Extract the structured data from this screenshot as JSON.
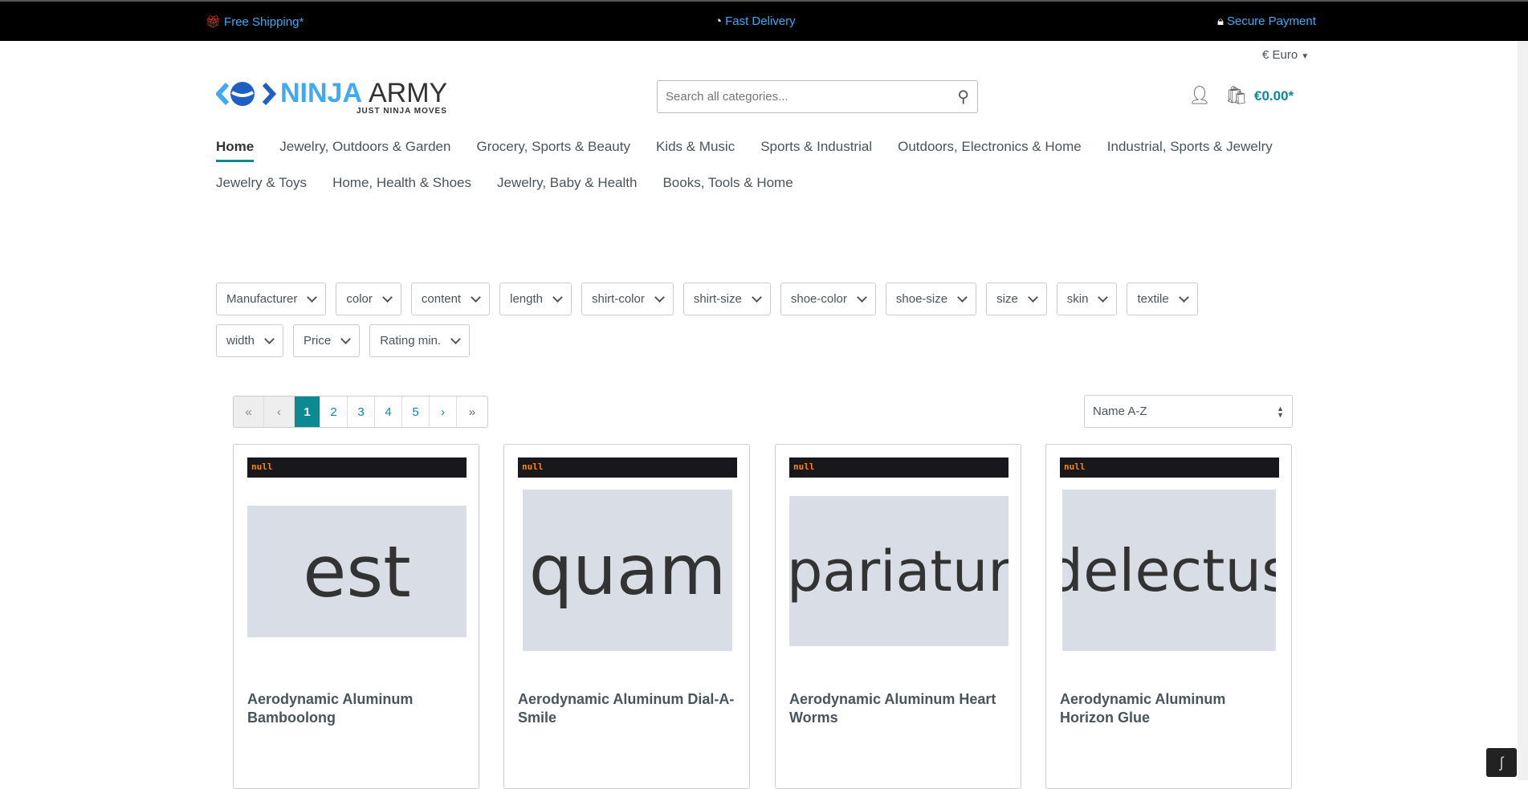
{
  "topbar": {
    "shipping": "Free Shipping*",
    "delivery": "Fast Delivery",
    "payment": "Secure Payment"
  },
  "header": {
    "currency": "€ Euro",
    "search_placeholder": "Search all categories...",
    "cart_total": "€0.00*",
    "logo_text": "NINJA ARMY",
    "logo_tagline": "JUST NINJA MOVES"
  },
  "nav": {
    "row1": [
      "Home",
      "Jewelry, Outdoors & Garden",
      "Grocery, Sports & Beauty",
      "Kids & Music",
      "Sports & Industrial",
      "Outdoors, Electronics & Home",
      "Industrial, Sports & Jewelry"
    ],
    "row2": [
      "Jewelry & Toys",
      "Home, Health & Shoes",
      "Jewelry, Baby & Health",
      "Books, Tools & Home"
    ]
  },
  "filters": {
    "row1": [
      "Manufacturer",
      "color",
      "content",
      "length",
      "shirt-color",
      "shirt-size",
      "shoe-color",
      "shoe-size",
      "size",
      "skin",
      "textile"
    ],
    "row2": [
      "width",
      "Price",
      "Rating min."
    ]
  },
  "pagination": {
    "first": "«",
    "prev": "‹",
    "pages": [
      "1",
      "2",
      "3",
      "4",
      "5"
    ],
    "current": "1",
    "next": "›",
    "last": "»"
  },
  "sort": {
    "selected": "Name A-Z"
  },
  "products": [
    {
      "badge": "null",
      "image_text": "est",
      "name": "Aerodynamic Aluminum Bamboolong"
    },
    {
      "badge": "null",
      "image_text": "quam",
      "name": "Aerodynamic Aluminum Dial-A-Smile"
    },
    {
      "badge": "null",
      "image_text": "pariatur",
      "name": "Aerodynamic Aluminum Heart Worms"
    },
    {
      "badge": "null",
      "image_text": "delectus",
      "name": "Aerodynamic Aluminum Horizon Glue"
    }
  ],
  "colors": {
    "accent": "#0b8a94",
    "topbar_text": "#3fa9f5",
    "badge_text": "#ff8400"
  }
}
